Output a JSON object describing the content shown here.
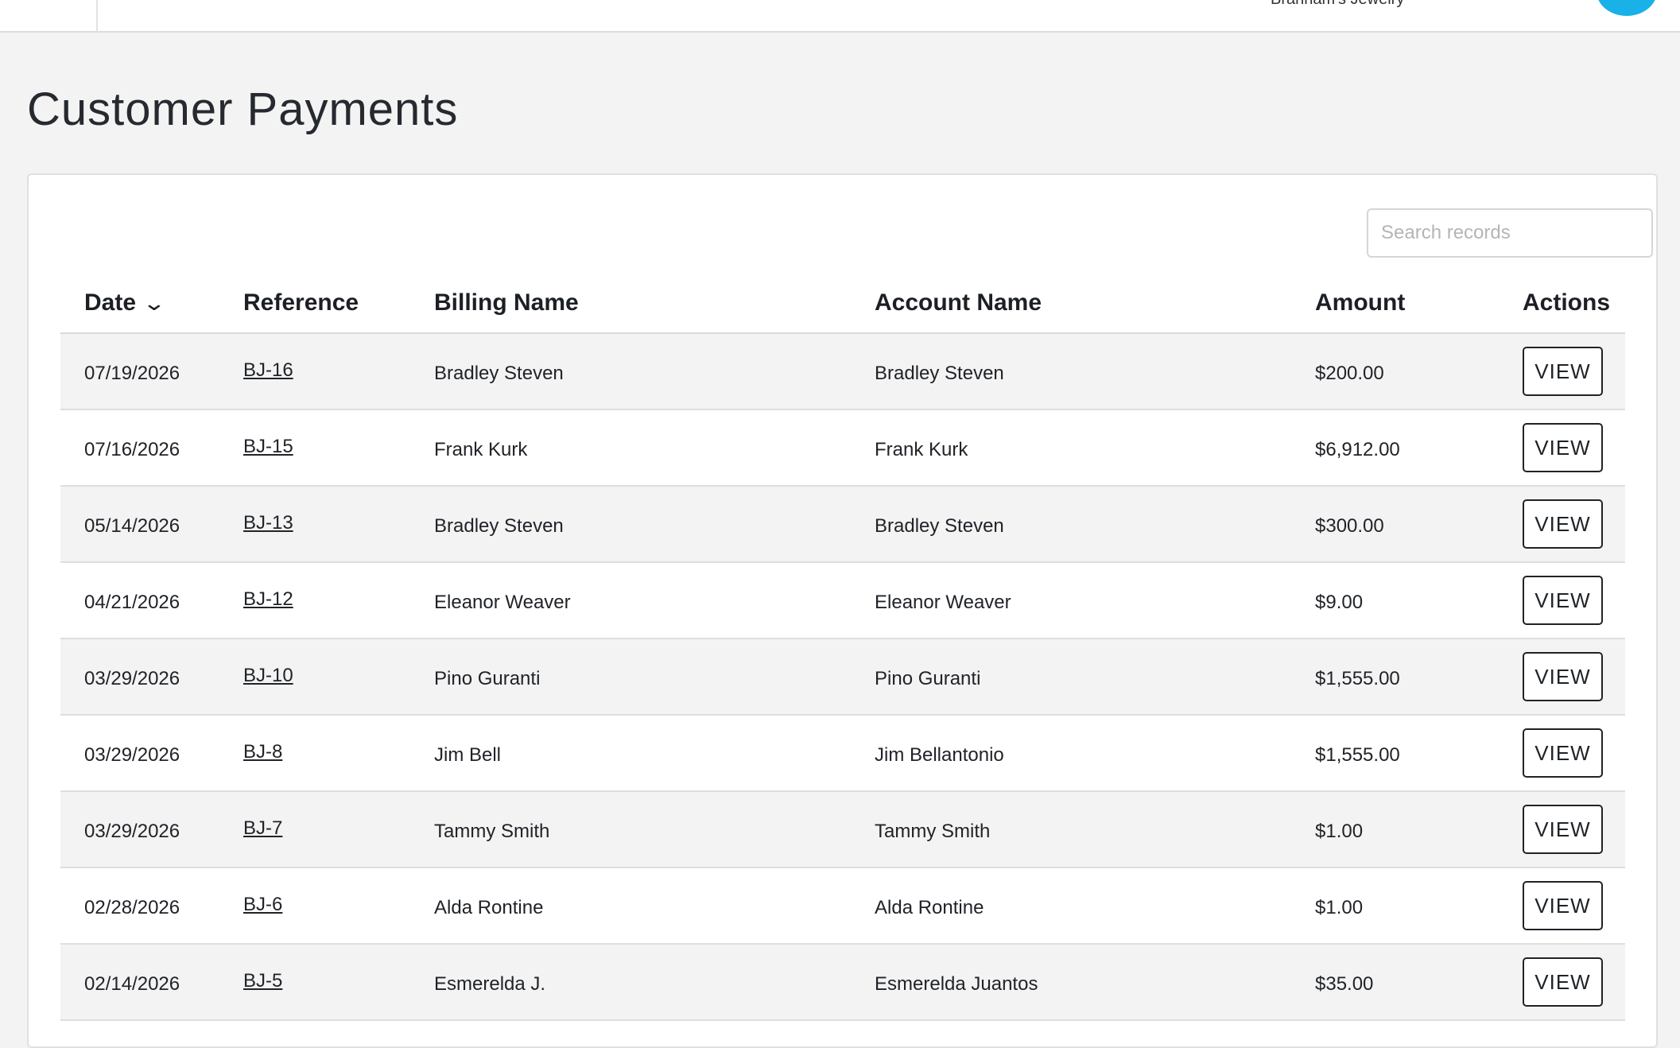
{
  "header": {
    "company_name": "Branham's Jewelry",
    "avatar_color": "#1ab0e8"
  },
  "page": {
    "title": "Customer Payments"
  },
  "search": {
    "placeholder": "Search records"
  },
  "table": {
    "columns": {
      "date": "Date",
      "reference": "Reference",
      "billing_name": "Billing Name",
      "account_name": "Account Name",
      "amount": "Amount",
      "actions": "Actions"
    },
    "sort_indicator": "chevron-down-icon",
    "rows": [
      {
        "date": "07/19/2026",
        "reference": "BJ-16",
        "billing_name": "Bradley Steven",
        "account_name": "Bradley Steven",
        "amount": "$200.00",
        "action": "VIEW"
      },
      {
        "date": "07/16/2026",
        "reference": "BJ-15",
        "billing_name": "Frank Kurk",
        "account_name": "Frank Kurk",
        "amount": "$6,912.00",
        "action": "VIEW"
      },
      {
        "date": "05/14/2026",
        "reference": "BJ-13",
        "billing_name": "Bradley Steven",
        "account_name": "Bradley Steven",
        "amount": "$300.00",
        "action": "VIEW"
      },
      {
        "date": "04/21/2026",
        "reference": "BJ-12",
        "billing_name": "Eleanor Weaver",
        "account_name": "Eleanor Weaver",
        "amount": "$9.00",
        "action": "VIEW"
      },
      {
        "date": "03/29/2026",
        "reference": "BJ-10",
        "billing_name": "Pino Guranti",
        "account_name": "Pino Guranti",
        "amount": "$1,555.00",
        "action": "VIEW"
      },
      {
        "date": "03/29/2026",
        "reference": "BJ-8",
        "billing_name": "Jim Bell",
        "account_name": "Jim Bellantonio",
        "amount": "$1,555.00",
        "action": "VIEW"
      },
      {
        "date": "03/29/2026",
        "reference": "BJ-7",
        "billing_name": "Tammy Smith",
        "account_name": "Tammy Smith",
        "amount": "$1.00",
        "action": "VIEW"
      },
      {
        "date": "02/28/2026",
        "reference": "BJ-6",
        "billing_name": "Alda Rontine",
        "account_name": "Alda Rontine",
        "amount": "$1.00",
        "action": "VIEW"
      },
      {
        "date": "02/14/2026",
        "reference": "BJ-5",
        "billing_name": "Esmerelda J.",
        "account_name": "Esmerelda Juantos",
        "amount": "$35.00",
        "action": "VIEW"
      }
    ]
  }
}
